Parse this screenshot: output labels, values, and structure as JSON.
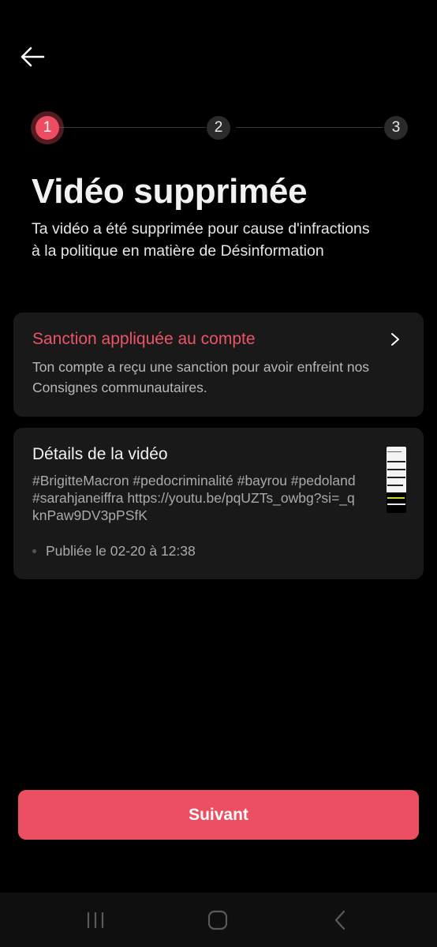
{
  "steps": [
    "1",
    "2",
    "3"
  ],
  "active_step": 1,
  "title": "Vidéo supprimée",
  "subtitle": "Ta vidéo a été supprimée pour cause d'infractions à la politique en matière de Désinformation",
  "sanction": {
    "title": "Sanction appliquée au compte",
    "description": "Ton compte a reçu une sanction pour avoir enfreint nos Consignes communautaires."
  },
  "video_details": {
    "title": "Détails de la vidéo",
    "caption": "#BrigitteMacron #pedocriminalité #bayrou #pedoland #sarahjaneiffra https://youtu.be/pqUZTs_owbg?si=_qknPaw9DV3pPSfK",
    "published": "Publiée le 02-20 à 12:38"
  },
  "next_button": {
    "label": "Suivant"
  },
  "icons": {
    "back": "back-arrow-icon",
    "chevron": "chevron-right-icon",
    "nav_recents": "recent-apps-icon",
    "nav_home": "home-icon",
    "nav_back": "nav-back-icon"
  },
  "colors": {
    "accent": "#ec4e62",
    "background": "#000000",
    "card": "#191919"
  }
}
